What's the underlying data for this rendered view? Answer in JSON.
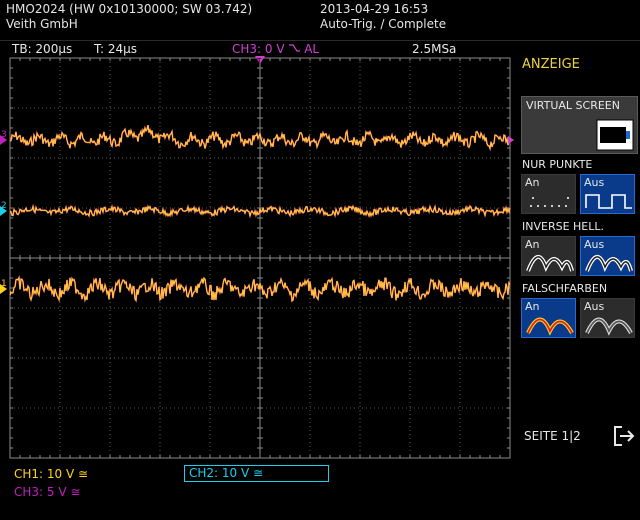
{
  "header": {
    "model": "HMO2024 (HW 0x10130000; SW 03.742)",
    "vendor": "Veith GmbH",
    "datetime": "2013-04-29 16:53",
    "trigger_status": "Auto-Trig. / Complete"
  },
  "status_bar": {
    "timebase": "TB: 200µs",
    "trigger_pos": "T: 24µs",
    "trigger_info": "CH3: 0 V",
    "trigger_coupling": "AL",
    "sample_rate": "2.5MSa"
  },
  "side_menu": {
    "title": "ANZEIGE",
    "virtual_screen_label": "VIRTUAL SCREEN",
    "groups": [
      {
        "label": "NUR PUNKTE",
        "options": [
          "An",
          "Aus"
        ],
        "selected": "Aus"
      },
      {
        "label": "INVERSE HELL.",
        "options": [
          "An",
          "Aus"
        ],
        "selected": "Aus"
      },
      {
        "label": "FALSCHFARBEN",
        "options": [
          "An",
          "Aus"
        ],
        "selected": "An"
      }
    ],
    "page_label": "SEITE 1|2"
  },
  "channels": [
    {
      "name": "CH1",
      "status": "CH1: 10 V ≅",
      "marker": "1",
      "color": "#ffd21c"
    },
    {
      "name": "CH2",
      "status": "CH2: 10 V ≅",
      "marker": "2",
      "color": "#1ccfe8"
    },
    {
      "name": "CH3",
      "status": "CH3: 5 V ≅",
      "marker": "3",
      "color": "#c020c0"
    }
  ],
  "colors": {
    "trace_main": "#ffcc33",
    "trace_alt": "#ff3f9f",
    "grid": "#5a5a5a",
    "menu_selected": "#0a3b8a",
    "accent_yellow": "#f0d23a"
  },
  "trigger_marker": "T"
}
